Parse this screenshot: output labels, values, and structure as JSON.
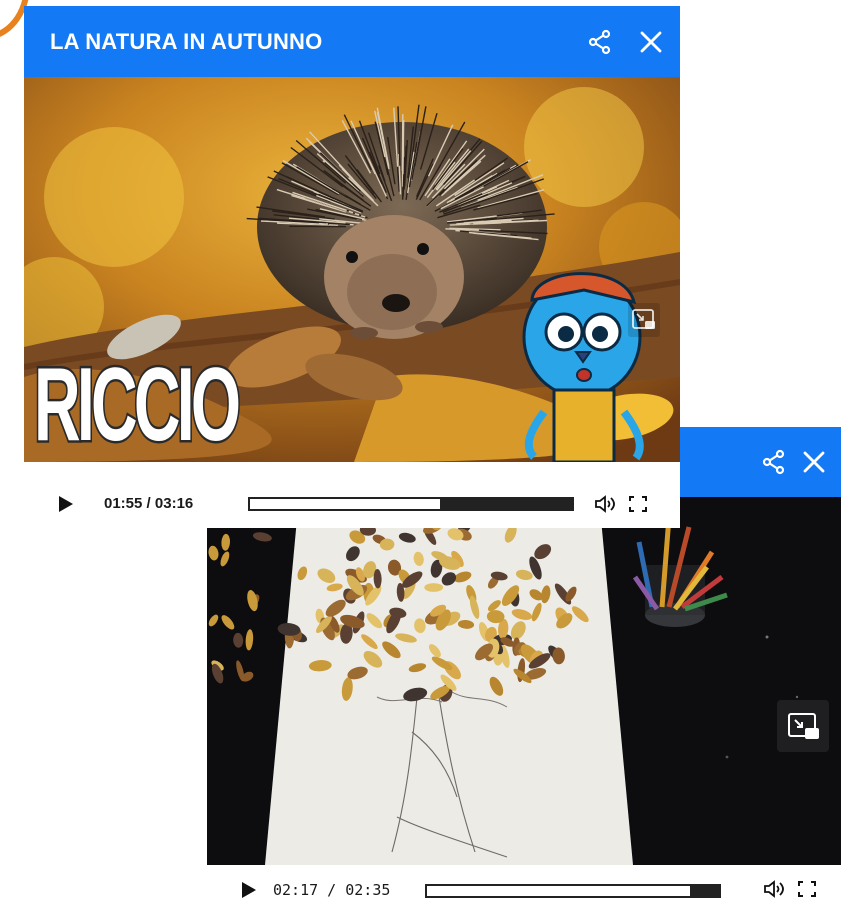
{
  "player_front": {
    "title": "LA NATURA IN AUTUNNO",
    "video_caption": "RICCIO",
    "current_time": "01:55",
    "duration": "03:16",
    "time_separator": " / ",
    "progress_fraction": 0.59,
    "icons": {
      "share": "share-icon",
      "close": "close-icon",
      "pip": "picture-in-picture-icon",
      "play": "play-icon",
      "volume": "volume-icon",
      "fullscreen": "fullscreen-icon"
    }
  },
  "player_back": {
    "current_time": "02:17",
    "duration": "02:35",
    "time_separator": " / ",
    "progress_fraction": 0.9,
    "icons": {
      "share": "share-icon",
      "close": "close-icon",
      "pip": "picture-in-picture-icon",
      "play": "play-icon",
      "volume": "volume-icon",
      "fullscreen": "fullscreen-icon"
    }
  },
  "colors": {
    "header_blue": "#1479f5",
    "accent_orange": "#e8821e",
    "control_dark": "#222222"
  }
}
